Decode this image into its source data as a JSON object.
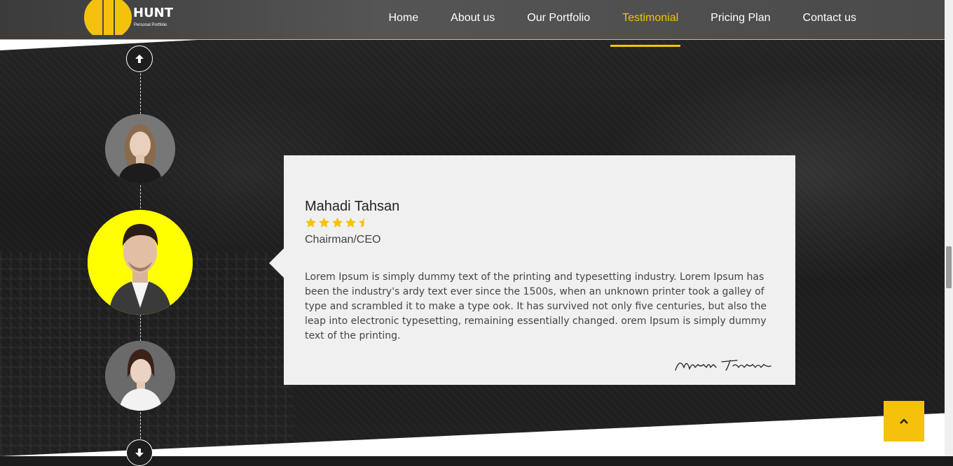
{
  "brand": {
    "name": "HUNT",
    "tagline": "Personal Portfolio",
    "accent_color": "#f4c20d"
  },
  "nav": {
    "items": [
      {
        "label": "Home",
        "active": false
      },
      {
        "label": "About us",
        "active": false
      },
      {
        "label": "Our Portfolio",
        "active": false
      },
      {
        "label": "Testimonial",
        "active": true
      },
      {
        "label": "Pricing Plan",
        "active": false
      },
      {
        "label": "Contact us",
        "active": false
      }
    ]
  },
  "timeline": {
    "up_icon": "arrow-up-icon",
    "down_icon": "arrow-down-icon",
    "avatars": [
      {
        "desc": "woman-long-hair",
        "selected": false
      },
      {
        "desc": "man-suit",
        "selected": true
      },
      {
        "desc": "woman-short-hair",
        "selected": false
      }
    ]
  },
  "testimonial": {
    "name": "Mahadi Tahsan",
    "rating": 4.5,
    "rating_max": 5,
    "role": "Chairman/CEO",
    "quote": "Lorem Ipsum is simply dummy text of the printing and typesetting industry. Lorem Ipsum has been the industry's ardy text ever since the 1500s, when an unknown printer took a galley of type and scrambled it to make a type ook. It has survived not only five centuries, but also the leap into electronic typesetting, remaining essentially changed. orem Ipsum is simply dummy text of the printing.",
    "signature": "Mahadi Tahsan"
  },
  "back_to_top": {
    "icon": "chevron-up-icon"
  }
}
